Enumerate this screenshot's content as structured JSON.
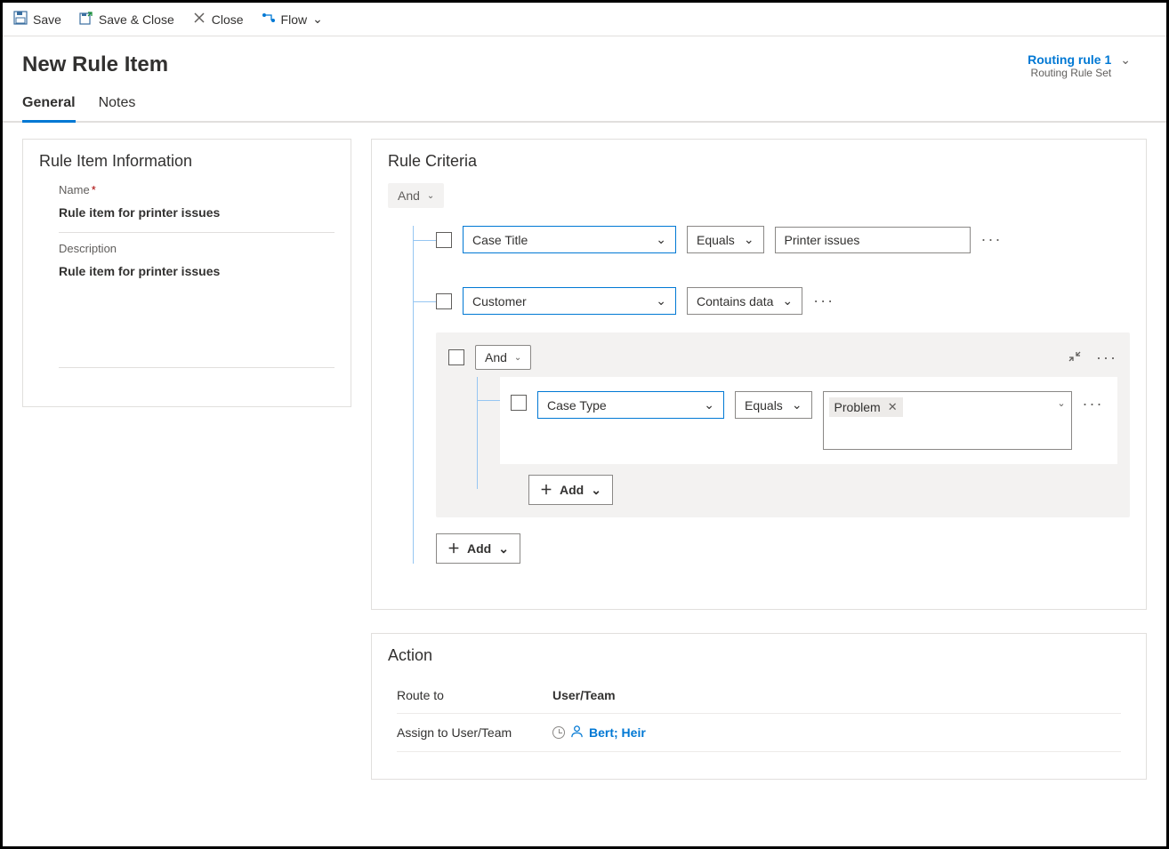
{
  "toolbar": {
    "save": "Save",
    "saveClose": "Save & Close",
    "close": "Close",
    "flow": "Flow"
  },
  "header": {
    "title": "New Rule Item",
    "relatedLink": "Routing rule 1",
    "relatedSub": "Routing Rule Set"
  },
  "tabs": {
    "general": "General",
    "notes": "Notes"
  },
  "info": {
    "sectionTitle": "Rule Item Information",
    "nameLabel": "Name",
    "nameValue": "Rule item for printer issues",
    "descLabel": "Description",
    "descValue": "Rule item for printer issues"
  },
  "criteria": {
    "sectionTitle": "Rule Criteria",
    "rootOp": "And",
    "rows": [
      {
        "field": "Case Title",
        "op": "Equals",
        "value": "Printer issues"
      },
      {
        "field": "Customer",
        "op": "Contains data"
      }
    ],
    "nested": {
      "op": "And",
      "row": {
        "field": "Case Type",
        "op": "Equals",
        "tag": "Problem"
      },
      "addLabel": "Add"
    },
    "addLabel": "Add"
  },
  "action": {
    "sectionTitle": "Action",
    "routeToLabel": "Route to",
    "routeToValue": "User/Team",
    "assignLabel": "Assign to User/Team",
    "assignValue": "Bert; Heir"
  }
}
